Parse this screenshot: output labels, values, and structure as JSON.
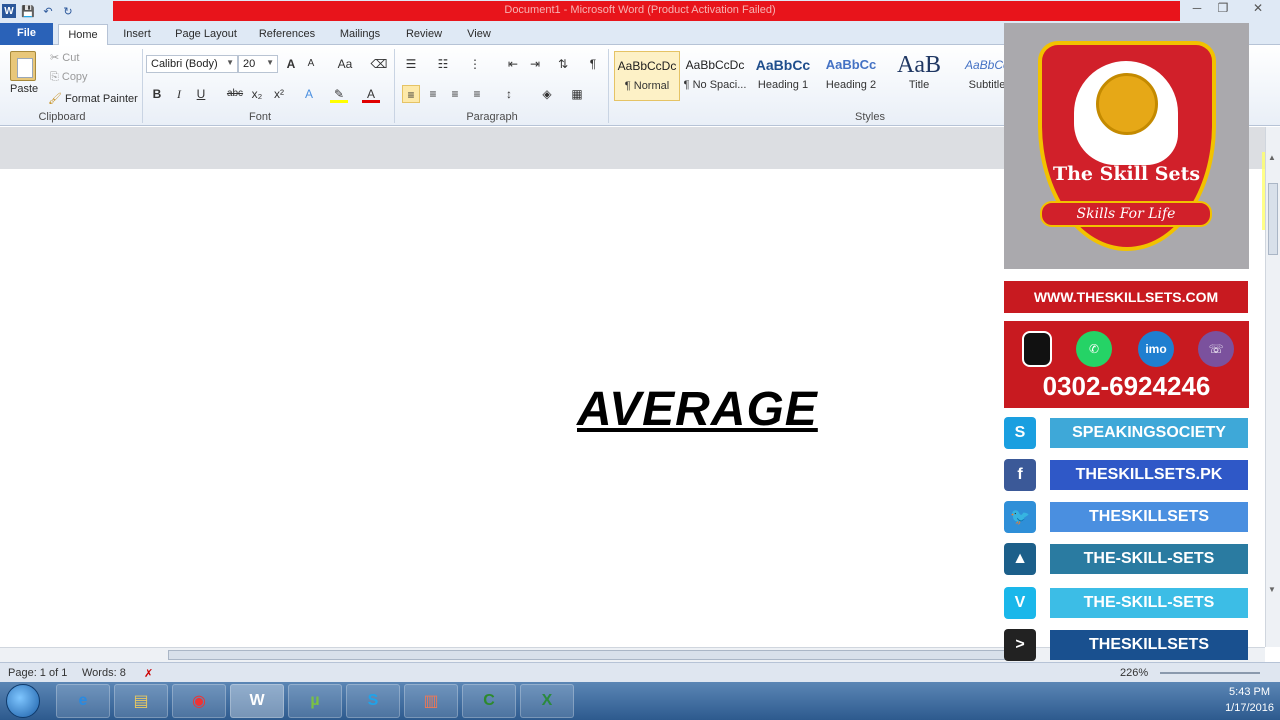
{
  "window": {
    "title": "Document1 - Microsoft Word (Product Activation Failed)",
    "controls": [
      "─",
      "❐",
      "✕"
    ]
  },
  "qat": {
    "app_icon": "W",
    "save": "💾",
    "undo": "↶",
    "redo": "↻"
  },
  "tabs": {
    "file": "File",
    "home": "Home",
    "insert": "Insert",
    "page_layout": "Page Layout",
    "references": "References",
    "mailings": "Mailings",
    "review": "Review",
    "view": "View"
  },
  "clipboard": {
    "label": "Clipboard",
    "paste": "Paste",
    "cut": "Cut",
    "copy": "Copy",
    "format_painter": "Format Painter"
  },
  "font": {
    "label": "Font",
    "name": "Calibri (Body)",
    "size": "20",
    "bold": "B",
    "italic": "I",
    "underline": "U",
    "strike": "abc",
    "subscript": "x₂",
    "superscript": "x²",
    "grow": "A",
    "shrink": "A",
    "case": "Aa"
  },
  "paragraph": {
    "label": "Paragraph",
    "pilcrow": "¶"
  },
  "styles": {
    "label": "Styles",
    "items": [
      {
        "preview": "AaBbCcDc",
        "label": "¶ Normal"
      },
      {
        "preview": "AaBbCcDc",
        "label": "¶ No Spaci..."
      },
      {
        "preview": "AaBbCc",
        "label": "Heading 1"
      },
      {
        "preview": "AaBbCc",
        "label": "Heading 2"
      },
      {
        "preview": "AaB",
        "label": "Title"
      },
      {
        "preview": "AaBbCc",
        "label": "Subtitle"
      }
    ]
  },
  "document": {
    "text": "AVERAGE"
  },
  "statusbar": {
    "page": "Page: 1 of 1",
    "words": "Words: 8",
    "zoom": "226%"
  },
  "taskbar": {
    "time": "5:43 PM",
    "date": "1/17/2016"
  },
  "overlay": {
    "brand": "The Skill Sets",
    "tagline": "Skills For Life",
    "website": "WWW.THESKILLSETS.COM",
    "phone": "0302-6924246",
    "contact_icons": [
      "imo"
    ],
    "social": [
      {
        "icon": "skype-icon",
        "label": "SPEAKINGSOCIETY",
        "color": "#3ea8d8",
        "icon_color": "#1a9fe0"
      },
      {
        "icon": "facebook-icon",
        "label": "THESKILLSETS.PK",
        "color": "#2f58c7",
        "icon_color": "#3b5998"
      },
      {
        "icon": "twitter-icon",
        "label": "THESKILLSETS",
        "color": "#4a8fe0",
        "icon_color": "#2f8fd8"
      },
      {
        "icon": "dailymotion-icon",
        "label": "THE-SKILL-SETS",
        "color": "#2a7ba1",
        "icon_color": "#1c5f8a"
      },
      {
        "icon": "vimeo-icon",
        "label": "THE-SKILL-SETS",
        "color": "#3cbde6",
        "icon_color": "#1ab7ea"
      },
      {
        "icon": "youtube-gaming-icon",
        "label": "THESKILLSETS",
        "color": "#19508f",
        "icon_color": "#222"
      }
    ]
  }
}
